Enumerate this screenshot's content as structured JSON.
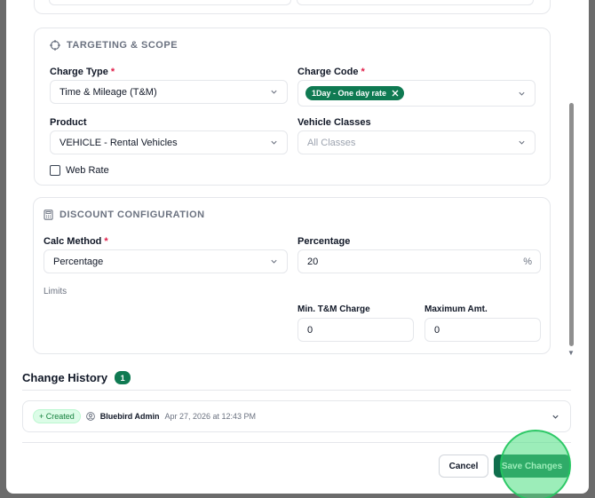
{
  "targeting": {
    "title": "TARGETING & SCOPE",
    "charge_type": {
      "label": "Charge Type",
      "value": "Time & Mileage (T&M)"
    },
    "charge_code": {
      "label": "Charge Code",
      "tag": "1Day - One day rate"
    },
    "product": {
      "label": "Product",
      "value": "VEHICLE - Rental Vehicles"
    },
    "vehicle_classes": {
      "label": "Vehicle Classes",
      "placeholder": "All Classes"
    },
    "web_rate": {
      "label": "Web Rate"
    }
  },
  "discount": {
    "title": "DISCOUNT CONFIGURATION",
    "calc_method": {
      "label": "Calc Method",
      "value": "Percentage"
    },
    "percentage": {
      "label": "Percentage",
      "value": "20",
      "suffix": "%"
    },
    "limits_label": "Limits",
    "min_tm": {
      "label": "Min. T&M Charge",
      "value": "0"
    },
    "max_amt": {
      "label": "Maximum Amt.",
      "value": "0"
    }
  },
  "history": {
    "title": "Change History",
    "count": "1",
    "entries": [
      {
        "action": "+ Created",
        "user": "Bluebird Admin",
        "time": "Apr 27, 2026 at 12:43 PM"
      }
    ]
  },
  "footer": {
    "cancel_label": "Cancel",
    "save_label": "Save Changes"
  },
  "colors": {
    "accent": "#0f7a52",
    "required": "#e11d48"
  }
}
